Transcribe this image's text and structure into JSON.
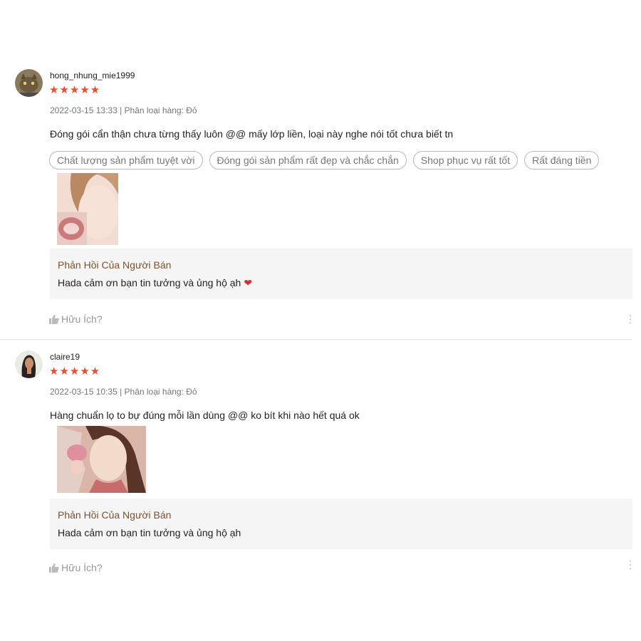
{
  "reviews": [
    {
      "username": "hong_nhung_mie1999",
      "stars": "★★★★★",
      "meta": "2022-03-15 13:33 | Phân loại hàng: Đỏ",
      "comment": "Đóng gói cẩn thận chưa từng thấy luôn @@ mấy lớp liền, loại này nghe nói tốt chưa biết tn",
      "tags": [
        "Chất lượng sản phẩm tuyệt vời",
        "Đóng gói sản phẩm rất đẹp và chắc chắn",
        "Shop phục vụ rất tốt",
        "Rất đáng tiền"
      ],
      "reply_title": "Phản Hồi Của Người Bán",
      "reply_text": "Hada cảm ơn bạn tin tưởng và ủng hộ ạh",
      "reply_emoji": "❤",
      "helpful_label": "Hữu Ích?"
    },
    {
      "username": "claire19",
      "stars": "★★★★★",
      "meta": "2022-03-15 10:35 | Phân loại hàng: Đỏ",
      "comment": "Hàng chuẩn lọ to bự đúng mỗi lần dùng @@ ko bít khi nào hết quá ok",
      "reply_title": "Phản Hồi Của Người Bán",
      "reply_text": "Hada cảm ơn bạn tin tưởng và ủng hộ ạh",
      "helpful_label": "Hữu Ích?"
    }
  ],
  "colors": {
    "star": "#ee4d2d",
    "reply_title": "#7a5230",
    "reply_bg": "#f5f5f5"
  },
  "icons": [
    "thumbs-up-icon",
    "more-vertical-icon",
    "heart-icon"
  ]
}
